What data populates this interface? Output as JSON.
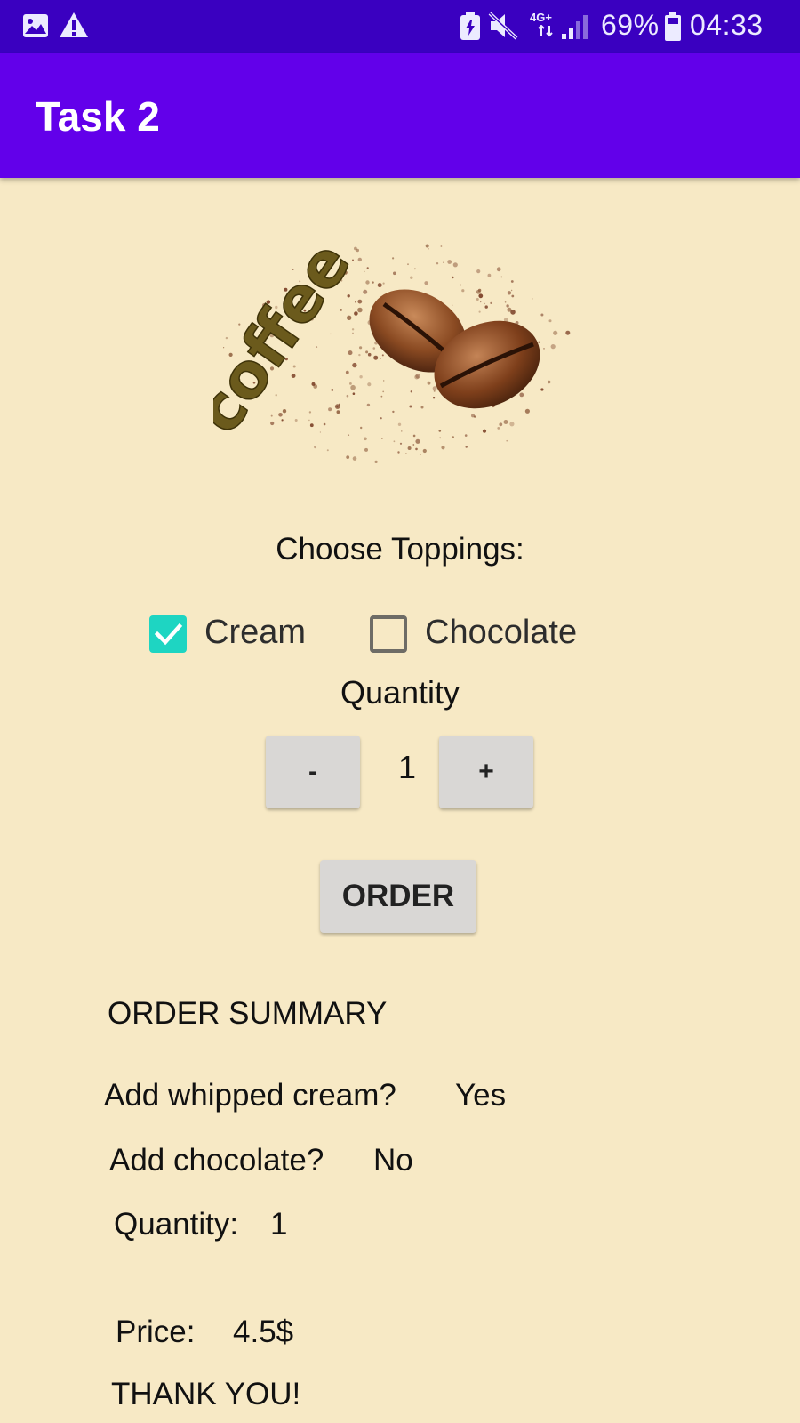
{
  "status_bar": {
    "network": "4G+",
    "battery": "69%",
    "time": "04:33",
    "icons": [
      "image-icon",
      "warning-icon",
      "battery-saver-icon",
      "mute-icon",
      "signal-icon",
      "battery-icon"
    ]
  },
  "app_bar": {
    "title": "Task 2"
  },
  "hero_image": {
    "text": "coffee",
    "description_icon": "coffee-beans-image"
  },
  "toppings": {
    "label": "Choose Toppings:",
    "options": [
      {
        "label": "Cream",
        "checked": true
      },
      {
        "label": "Chocolate",
        "checked": false
      }
    ]
  },
  "quantity": {
    "label": "Quantity",
    "decrement_label": "-",
    "value": "1",
    "increment_label": "+"
  },
  "order_button": {
    "label": "ORDER"
  },
  "summary": {
    "title": "ORDER SUMMARY",
    "cream_label": "Add whipped cream?",
    "cream_value": "Yes",
    "chocolate_label": "Add chocolate?",
    "chocolate_value": "No",
    "quantity_label": "Quantity:",
    "quantity_value": "1",
    "price_label": "Price:",
    "price_value": "4.5$",
    "thanks": "THANK YOU!"
  },
  "colors": {
    "status_bar": "#3a00c0",
    "app_bar": "#6200ea",
    "background": "#f7e9c5",
    "checkbox_accent": "#1ed5c2",
    "button": "#d9d7d5"
  }
}
